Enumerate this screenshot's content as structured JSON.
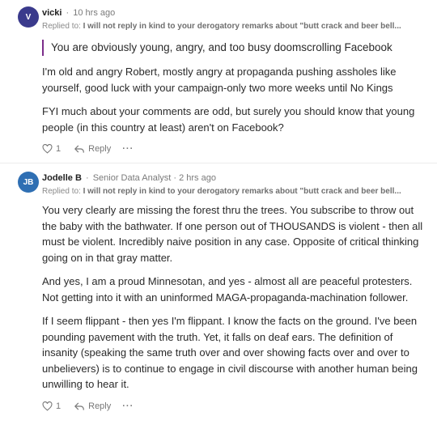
{
  "comments": [
    {
      "avatar": {
        "initials": "V",
        "color": "#3a3a8c"
      },
      "author": "vicki",
      "meta": "10 hrs ago",
      "reply_prefix": "Replied to:",
      "reply_text": "I will not reply in kind to your derogatory remarks about \"butt crack and beer bell...",
      "quote": "You are obviously young, angry, and too busy doomscrolling Facebook",
      "paragraphs": [
        "I'm old and angry Robert, mostly angry at propaganda pushing assholes like yourself, good luck with your campaign-only two more weeks until No Kings",
        "FYI much about your comments are odd, but surely you should know that young people (in this country at least) aren't on Facebook?"
      ],
      "likes": "1",
      "reply_label": "Reply",
      "more_label": "···"
    },
    {
      "avatar": {
        "initials": "JB",
        "color": "#2f6fb3"
      },
      "author": "Jodelle B",
      "meta": "Senior Data Analyst · 2 hrs ago",
      "reply_prefix": "Replied to:",
      "reply_text": "I will not reply in kind to your derogatory remarks about \"butt crack and beer bell...",
      "paragraphs": [
        "You very clearly are missing the forest thru the trees. You subscribe to throw out the baby with the bathwater. If one person out of THOUSANDS is violent - then all must be violent. Incredibly naive position in any case. Opposite of critical thinking going on in that gray matter.",
        "And yes, I am a proud Minnesotan, and yes - almost all are peaceful protesters. Not getting into it with an uninformed MAGA-propaganda-machination follower.",
        "If I seem flippant - then yes I'm flippant. I know the facts on the ground. I've been pounding pavement with the truth. Yet, it falls on deaf ears. The definition of insanity (speaking the same truth over and over showing facts over and over to unbelievers) is to continue to engage in civil discourse with another human being unwilling to hear it."
      ],
      "likes": "1",
      "reply_label": "Reply",
      "more_label": "···"
    }
  ]
}
